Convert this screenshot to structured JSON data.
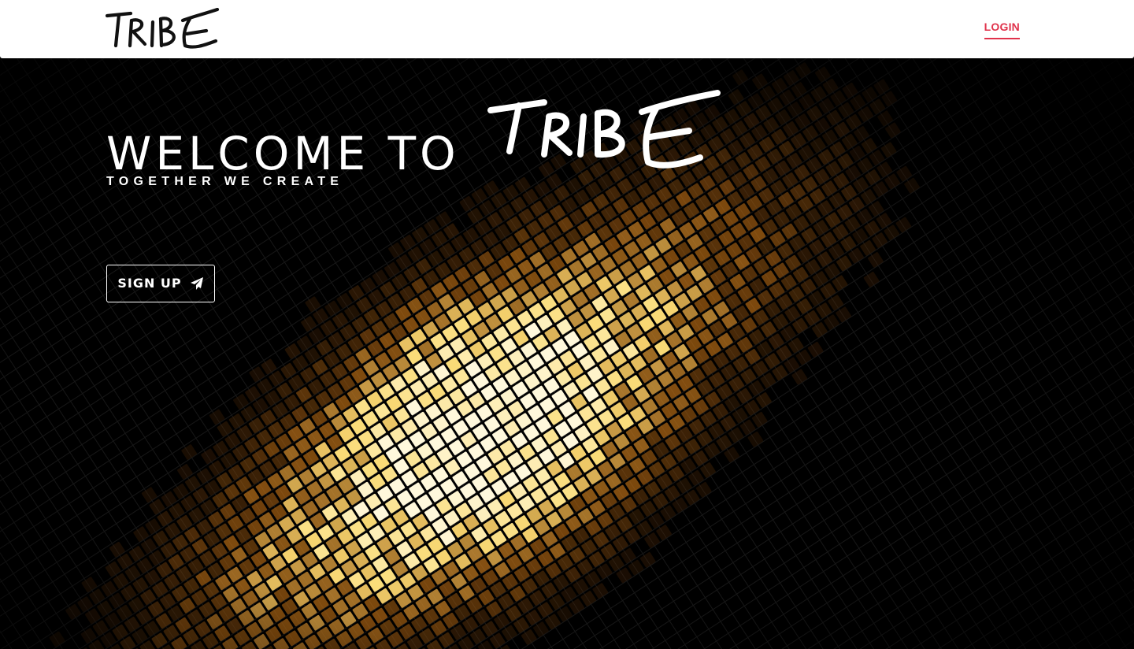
{
  "navbar": {
    "brand_logo_text": "TRIBE",
    "login_label": "LOGIN"
  },
  "hero": {
    "welcome_prefix": "WELCOME TO",
    "welcome_brand": "TRIBE",
    "tagline": "TOGETHER WE CREATE",
    "signup_label": "SIGN UP",
    "signup_icon": "paper-plane-icon"
  },
  "colors": {
    "accent": "#e0324b",
    "navbar_bg": "#ffffff",
    "hero_bg": "#000000",
    "text_light": "#ffffff",
    "tile_gold": "#e8a528"
  }
}
